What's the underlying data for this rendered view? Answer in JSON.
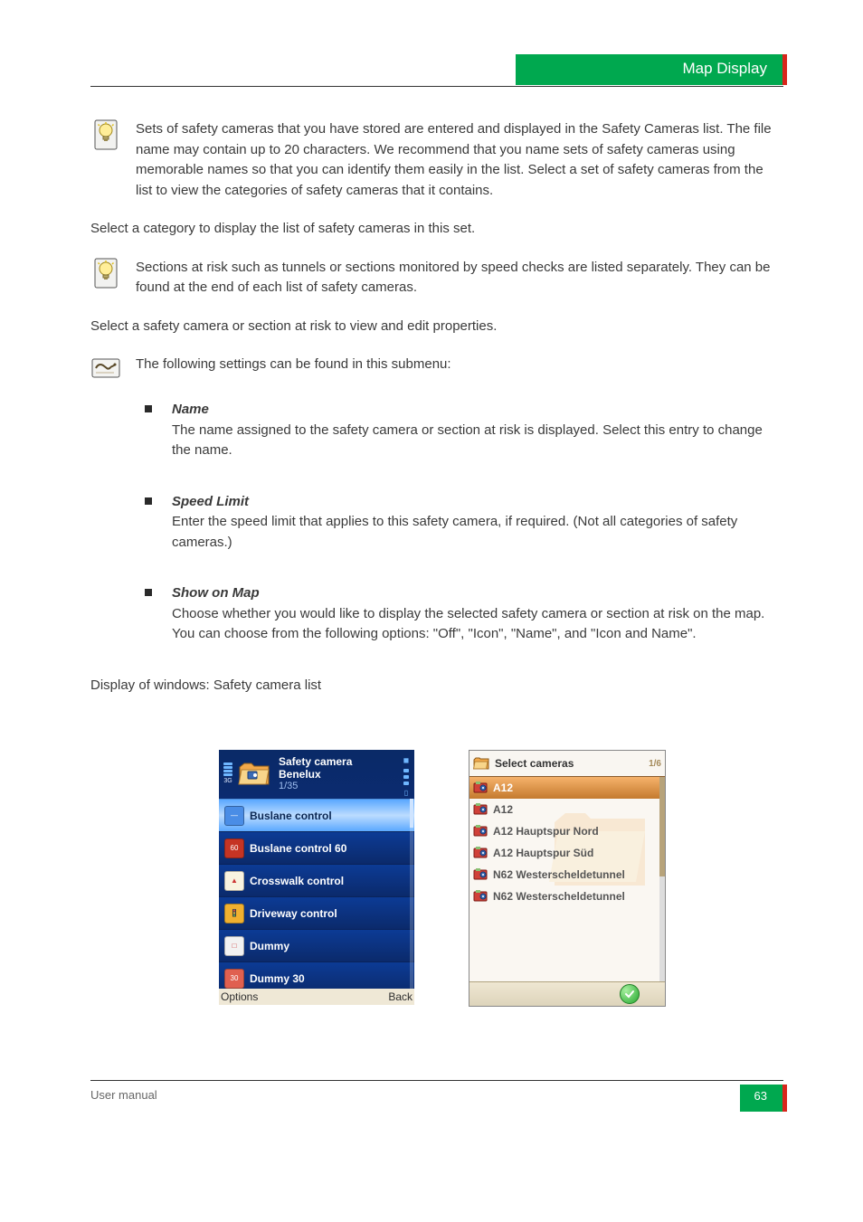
{
  "header": {
    "title": "Map Display"
  },
  "body": {
    "hint1": "Sets of safety cameras that you have stored are entered and displayed in the Safety Cameras list. The file name may contain up to 20 characters. We recommend that you name sets of safety cameras using memorable names so that you can identify them easily in the list. Select a set of safety cameras from the list to view the categories of safety cameras that it contains.",
    "para1": "Select a category to display the list of safety cameras in this set.",
    "hint2": "Sections at risk such as tunnels or sections monitored by speed checks are listed separately. They can be found at the end of each list of safety cameras.",
    "para2": "Select a safety camera or section at risk to view and edit properties.",
    "note": "The following settings can be found in this submenu:",
    "bullets": [
      {
        "label": "Name",
        "text": "The name assigned to the safety camera or section at risk is displayed. Select this entry to change the name."
      },
      {
        "label": "Speed Limit",
        "text": "Enter the speed limit that applies to this safety camera, if required. (Not all categories of safety cameras.)"
      },
      {
        "label": "Show on Map",
        "text": "Choose whether you would like to display the selected safety camera or section at risk on the map. You can choose from the following options: \"Off\", \"Icon\", \"Name\", and \"Icon and Name\"."
      }
    ],
    "windows_list": "Display of windows: Safety camera list"
  },
  "screenshot1": {
    "title_line1": "Safety camera",
    "title_line2": "Benelux",
    "count": "1/35",
    "items": [
      {
        "label": "Buslane control",
        "selected": true,
        "iconColor": "#4a8de6",
        "iconGlyph": "—"
      },
      {
        "label": "Buslane control 60",
        "selected": false,
        "iconColor": "#c53424",
        "iconGlyph": "60"
      },
      {
        "label": "Crosswalk control",
        "selected": false,
        "iconColor": "#f9f3e0",
        "iconGlyph": "▲"
      },
      {
        "label": "Driveway control",
        "selected": false,
        "iconColor": "#f0b030",
        "iconGlyph": "🚦"
      },
      {
        "label": "Dummy",
        "selected": false,
        "iconColor": "#f2f2f2",
        "iconGlyph": "□"
      },
      {
        "label": "Dummy 30",
        "selected": false,
        "iconColor": "#e06050",
        "iconGlyph": "30"
      }
    ],
    "softkey_left": "Options",
    "softkey_right": "Back"
  },
  "screenshot2": {
    "title": "Select cameras",
    "count": "1/6",
    "items": [
      {
        "label": "A12",
        "selected": true
      },
      {
        "label": "A12",
        "selected": false
      },
      {
        "label": "A12 Hauptspur Nord",
        "selected": false
      },
      {
        "label": "A12 Hauptspur Süd",
        "selected": false
      },
      {
        "label": "N62 Westerscheldetunnel",
        "selected": false
      },
      {
        "label": "N62 Westerscheldetunnel",
        "selected": false
      }
    ]
  },
  "footer": {
    "manual": "User manual",
    "page": "63"
  }
}
